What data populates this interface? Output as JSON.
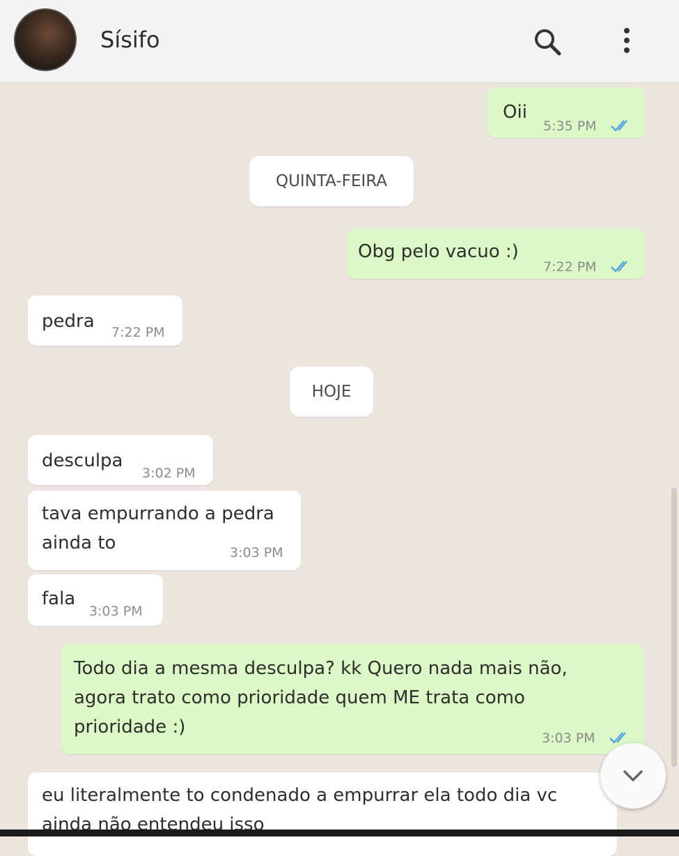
{
  "header": {
    "contact_name": "Sísifo",
    "search_icon": "search-icon",
    "menu_icon": "more-vertical-icon"
  },
  "messages": [
    {
      "direction": "out",
      "text": "Oii",
      "time": "5:35 PM",
      "status": "read"
    },
    {
      "type": "date_divider",
      "text": "QUINTA-FEIRA"
    },
    {
      "direction": "out",
      "text": "Obg pelo vacuo :)",
      "time": "7:22 PM",
      "status": "read"
    },
    {
      "direction": "in",
      "text": "pedra",
      "time": "7:22 PM"
    },
    {
      "type": "date_divider",
      "text": "HOJE"
    },
    {
      "direction": "in",
      "text": "desculpa",
      "time": "3:02 PM"
    },
    {
      "direction": "in",
      "lines": [
        "tava empurrando a pedra",
        "ainda to"
      ],
      "time": "3:03 PM"
    },
    {
      "direction": "in",
      "text": "fala",
      "time": "3:03 PM"
    },
    {
      "direction": "out",
      "lines": [
        "Todo dia a mesma desculpa? kk Quero nada mais não,",
        "agora trato como prioridade quem ME trata como",
        "prioridade :)"
      ],
      "time": "3:03 PM",
      "status": "read"
    },
    {
      "direction": "in",
      "lines": [
        "eu literalmente to condenado a empurrar ela todo dia vc",
        "ainda não entendeu isso"
      ]
    }
  ],
  "colors": {
    "outgoing_bubble": "#dcf8c6",
    "incoming_bubble": "#ffffff",
    "chat_background": "#ece6df",
    "read_ticks": "#4fa3e0"
  },
  "scroll_button_icon": "chevron-down-icon"
}
